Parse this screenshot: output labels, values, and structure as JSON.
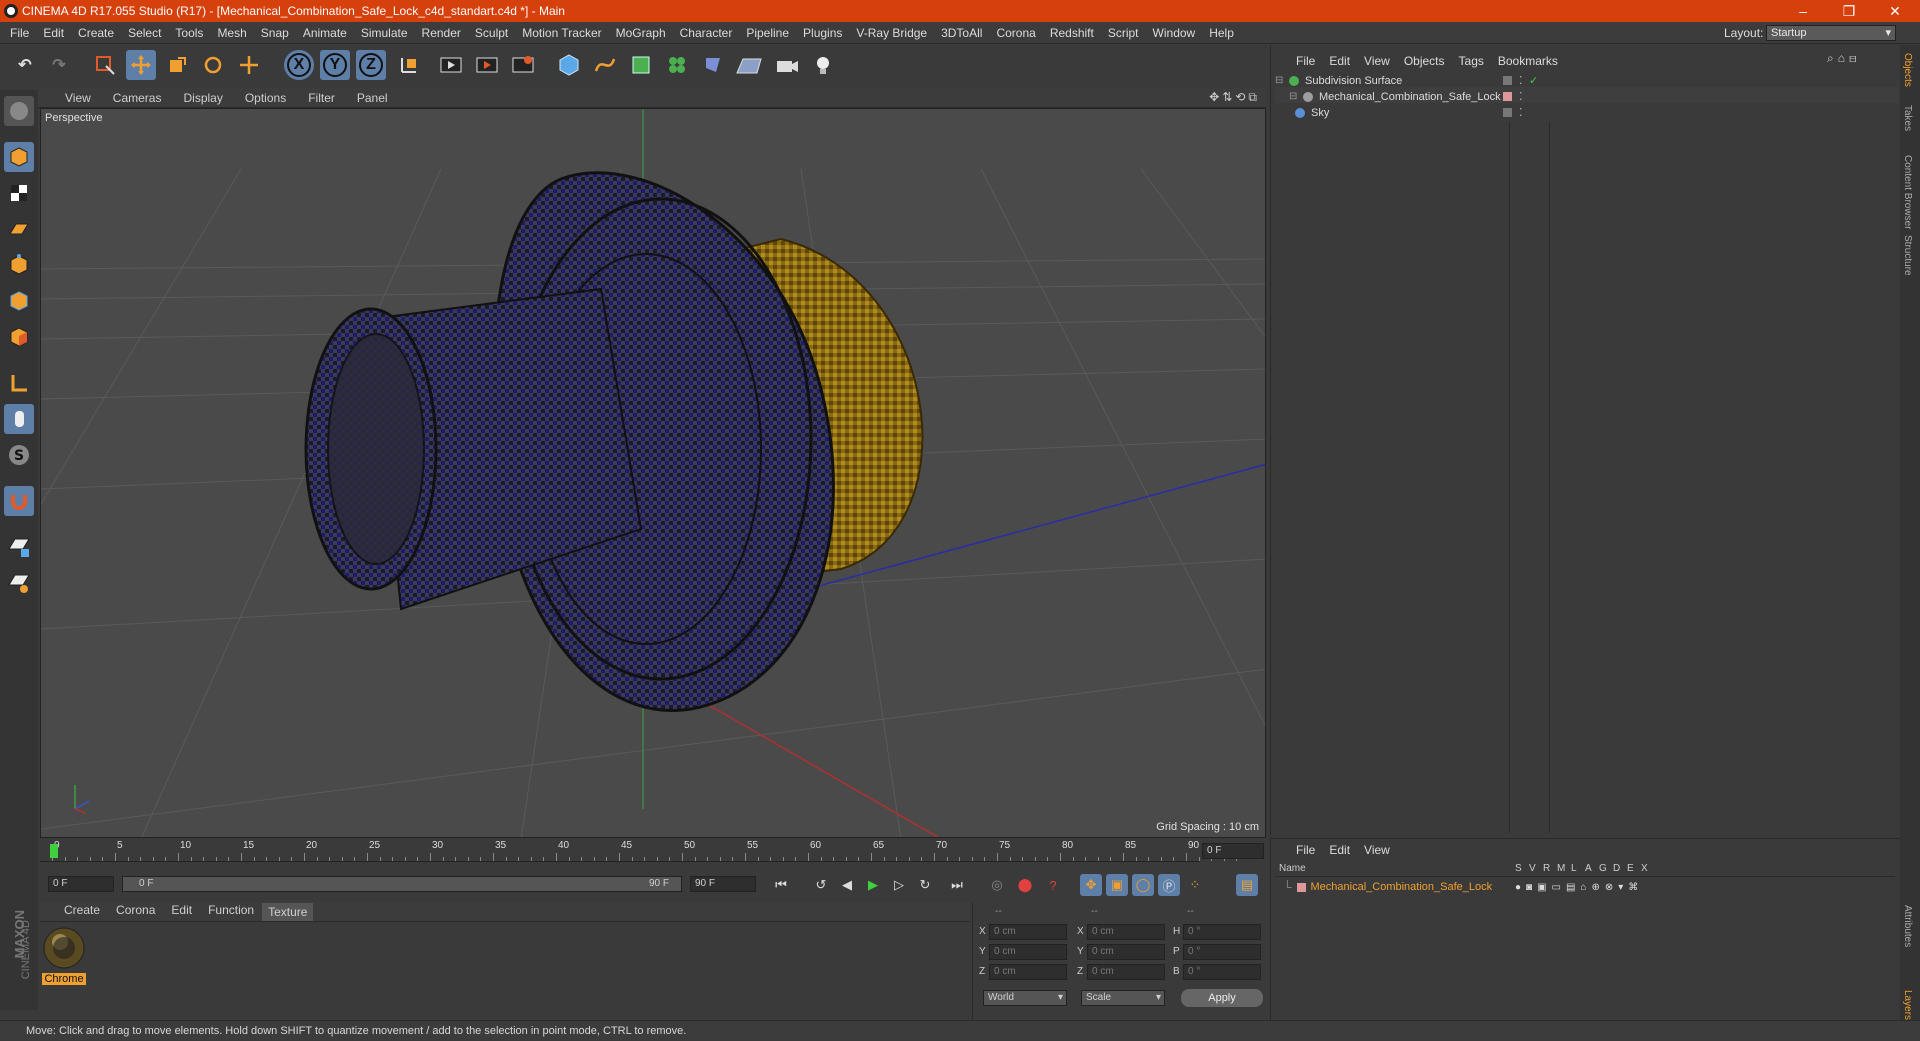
{
  "window": {
    "title": "CINEMA 4D R17.055 Studio (R17) - [Mechanical_Combination_Safe_Lock_c4d_standart.c4d *] - Main",
    "minimize": "–",
    "maximize": "❐",
    "close": "✕"
  },
  "menubar": {
    "items": [
      "File",
      "Edit",
      "Create",
      "Select",
      "Tools",
      "Mesh",
      "Snap",
      "Animate",
      "Simulate",
      "Render",
      "Sculpt",
      "Motion Tracker",
      "MoGraph",
      "Character",
      "Pipeline",
      "Plugins",
      "V-Ray Bridge",
      "3DToAll",
      "Corona",
      "Redshift",
      "Script",
      "Window",
      "Help"
    ],
    "layout_label": "Layout:",
    "layout_value": "Startup"
  },
  "toolbar": {
    "axis_x": "X",
    "axis_y": "Y",
    "axis_z": "Z"
  },
  "viewport": {
    "menu": [
      "View",
      "Cameras",
      "Display",
      "Options",
      "Filter",
      "Panel"
    ],
    "label": "Perspective",
    "grid_spacing": "Grid Spacing : 10 cm"
  },
  "timeline": {
    "ticks": [
      "0",
      "5",
      "10",
      "15",
      "20",
      "25",
      "30",
      "35",
      "40",
      "45",
      "50",
      "55",
      "60",
      "65",
      "70",
      "75",
      "80",
      "85",
      "90"
    ],
    "current_frame": "0 F"
  },
  "animation": {
    "start": "0 F",
    "range_start": "0 F",
    "range_end": "90 F",
    "end": "90 F"
  },
  "material_manager": {
    "menu": [
      "Create",
      "Corona",
      "Edit",
      "Function",
      "Texture"
    ],
    "materials": [
      {
        "name": "Chrome"
      }
    ]
  },
  "coordinates": {
    "headers": [
      "--",
      "--",
      "--"
    ],
    "rows": [
      {
        "l1": "X",
        "v1": "0 cm",
        "l2": "X",
        "v2": "0 cm",
        "l3": "H",
        "v3": "0 °"
      },
      {
        "l1": "Y",
        "v1": "0 cm",
        "l2": "Y",
        "v2": "0 cm",
        "l3": "P",
        "v3": "0 °"
      },
      {
        "l1": "Z",
        "v1": "0 cm",
        "l2": "Z",
        "v2": "0 cm",
        "l3": "B",
        "v3": "0 °"
      }
    ],
    "mode": "World",
    "size_mode": "Scale",
    "apply": "Apply"
  },
  "object_manager": {
    "menu": [
      "File",
      "Edit",
      "View",
      "Objects",
      "Tags",
      "Bookmarks"
    ],
    "objects": [
      {
        "name": "Subdivision Surface",
        "color": "#4caf50"
      },
      {
        "name": "Mechanical_Combination_Safe_Lock",
        "color": "#9e9e9e"
      },
      {
        "name": "Sky",
        "color": "#5b8fd6"
      }
    ]
  },
  "layer_manager": {
    "menu": [
      "File",
      "Edit",
      "View"
    ],
    "columns": [
      "Name",
      "S",
      "V",
      "R",
      "M",
      "L",
      "A",
      "G",
      "D",
      "E",
      "X"
    ],
    "layers": [
      {
        "name": "Mechanical_Combination_Safe_Lock",
        "color": "#f0a030"
      }
    ]
  },
  "side_tabs": [
    "Objects",
    "Takes",
    "Content Browser",
    "Structure",
    "Attributes",
    "Layers"
  ],
  "logo": {
    "brand": "MAXON",
    "product": "CINEMA 4D"
  },
  "status": "Move: Click and drag to move elements. Hold down SHIFT to quantize movement / add to the selection in point mode, CTRL to remove."
}
